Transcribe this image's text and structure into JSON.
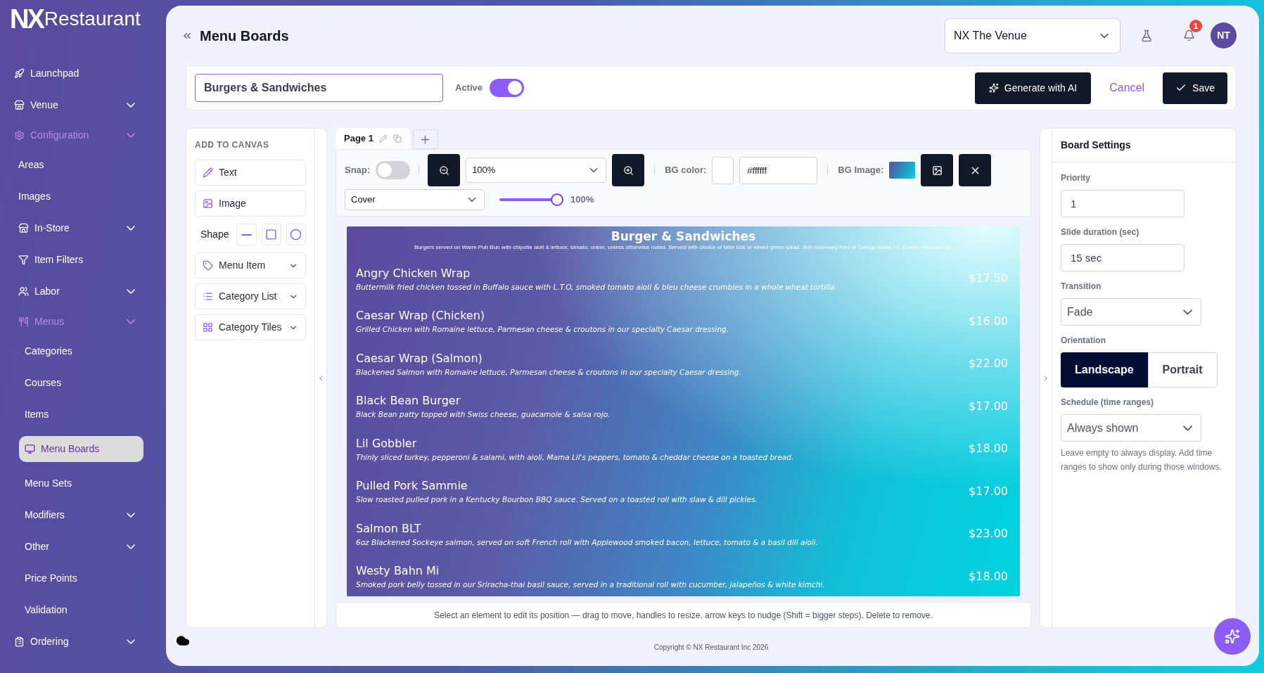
{
  "brand": {
    "logo": "NX",
    "name": "Restaurant"
  },
  "sidebar": {
    "items": [
      {
        "label": "Launchpad",
        "selected": false
      },
      {
        "label": "Venue",
        "selected": false,
        "expanded": false
      },
      {
        "label": "Configuration",
        "selected": false,
        "expanded": true,
        "children": [
          {
            "label": "Areas",
            "selected": false
          },
          {
            "label": "Images",
            "selected": false
          },
          {
            "label": "In-Store",
            "selected": false,
            "expanded": false
          },
          {
            "label": "Item Filters",
            "selected": false
          },
          {
            "label": "Labor",
            "selected": false,
            "expanded": false
          },
          {
            "label": "Menus",
            "selected": false,
            "expanded": true,
            "children": [
              {
                "label": "Categories",
                "selected": false
              },
              {
                "label": "Courses",
                "selected": false
              },
              {
                "label": "Items",
                "selected": false
              },
              {
                "label": "Menu Boards",
                "selected": true
              },
              {
                "label": "Menu Sets",
                "selected": false
              },
              {
                "label": "Modifiers",
                "selected": false,
                "expanded": false
              },
              {
                "label": "Other",
                "selected": false,
                "expanded": false
              },
              {
                "label": "Price Points",
                "selected": false
              },
              {
                "label": "Validation",
                "selected": false
              }
            ]
          }
        ]
      },
      {
        "label": "Ordering",
        "selected": false,
        "expanded": false
      }
    ]
  },
  "header": {
    "title": "Menu Boards",
    "venue_select": {
      "value": "NX The Venue"
    },
    "notifications": {
      "badge": "1"
    },
    "avatar": "NT"
  },
  "board_bar": {
    "name_field": {
      "value": "Burgers & Sandwiches"
    },
    "active": {
      "label": "Active",
      "on": true
    },
    "buttons": [
      {
        "label": "Generate with AI",
        "kind": "ai"
      },
      {
        "label": "Cancel",
        "kind": "link"
      },
      {
        "label": "Save",
        "kind": "save"
      }
    ]
  },
  "add_panel": {
    "title": "ADD TO CANVAS",
    "items": [
      {
        "label": "Text",
        "kind": "button"
      },
      {
        "label": "Image",
        "kind": "button"
      },
      {
        "label": "Shape",
        "kind": "shapes"
      },
      {
        "label": "Menu Item",
        "kind": "dropdown"
      },
      {
        "label": "Category List",
        "kind": "dropdown"
      },
      {
        "label": "Category Tiles",
        "kind": "dropdown"
      }
    ]
  },
  "pages": {
    "tabs": [
      {
        "label": "Page 1",
        "selected": true
      }
    ]
  },
  "toolbar": {
    "snap": {
      "label": "Snap:",
      "on": false
    },
    "zoom": {
      "value": "100%"
    },
    "bg_color": {
      "label": "BG color:",
      "value": "#ffffff"
    },
    "bg_image": {
      "label": "BG Image:"
    },
    "fit": {
      "value": "Cover"
    },
    "scale": {
      "level": 1,
      "reading": "100%"
    }
  },
  "canvas": {
    "title": "Burger & Sandwiches",
    "subtitle": "Burgers served on Warm Pub Bun with chipotle aioli & lettuce, tomato, onion, unless otherwise noted. Served with choice of tater tots or mixed green salad. Sub rosemary fries or Caesar salad +1, Gluten Free bun +2.",
    "items": [
      {
        "name": "Angry Chicken Wrap",
        "description": "Buttermilk fried chicken tossed in Buffalo sauce with L.T.O, smoked tomato aioli & bleu cheese crumbles in a whole wheat tortilla.",
        "price": "$17.50"
      },
      {
        "name": "Caesar Wrap (Chicken)",
        "description": "Grilled Chicken with Romaine lettuce, Parmesan cheese & croutons in our specialty Caesar dressing.",
        "price": "$16.00"
      },
      {
        "name": "Caesar Wrap (Salmon)",
        "description": "Blackened Salmon with Romaine lettuce, Parmesan cheese & croutons in our specialty Caesar dressing.",
        "price": "$22.00"
      },
      {
        "name": "Black Bean Burger",
        "description": "Black Bean patty topped with Swiss cheese, guacamole & salsa rojo.",
        "price": "$17.00"
      },
      {
        "name": "Lil Gobbler",
        "description": "Thinly sliced turkey, pepperoni & salami, with aioli, Mama Lil's peppers, tomato & cheddar cheese on a toasted bread.",
        "price": "$18.00"
      },
      {
        "name": "Pulled Pork Sammie",
        "description": "Slow roasted pulled pork in a Kentucky Bourbon BBQ sauce. Served on a toasted roll with slaw & dill pickles.",
        "price": "$17.00"
      },
      {
        "name": "Salmon BLT",
        "description": "6oz Blackened Sockeye salmon, served on soft French roll with Applewood smoked bacon, lettuce, tomato & a basil dill aioli.",
        "price": "$23.00"
      },
      {
        "name": "Westy Bahn Mi",
        "description": "Smoked pork belly tossed in our Sriracha-thai basil sauce, served in a traditional roll with cucumber, jalapeños & white kimchi.",
        "price": "$18.00"
      }
    ]
  },
  "hint": "Select an element to edit its position — drag to move, handles to resize, arrow keys to nudge (Shift = bigger steps), Delete to remove.",
  "settings": {
    "title": "Board Settings",
    "fields": [
      {
        "label": "Priority",
        "kind": "input",
        "value": "1"
      },
      {
        "label": "Slide duration (sec)",
        "kind": "input",
        "value": "15 sec"
      },
      {
        "label": "Transition",
        "kind": "select",
        "value": "Fade"
      },
      {
        "label": "Orientation",
        "kind": "segmented",
        "options": [
          {
            "label": "Landscape",
            "selected": true
          },
          {
            "label": "Portrait",
            "selected": false
          }
        ]
      },
      {
        "label": "Schedule (time ranges)",
        "kind": "select",
        "value": "Always shown",
        "help": "Leave empty to always display. Add time ranges to show only during those windows."
      }
    ]
  },
  "footer": {
    "copyright": "Copyright © NX Restaurant Inc 2026"
  }
}
